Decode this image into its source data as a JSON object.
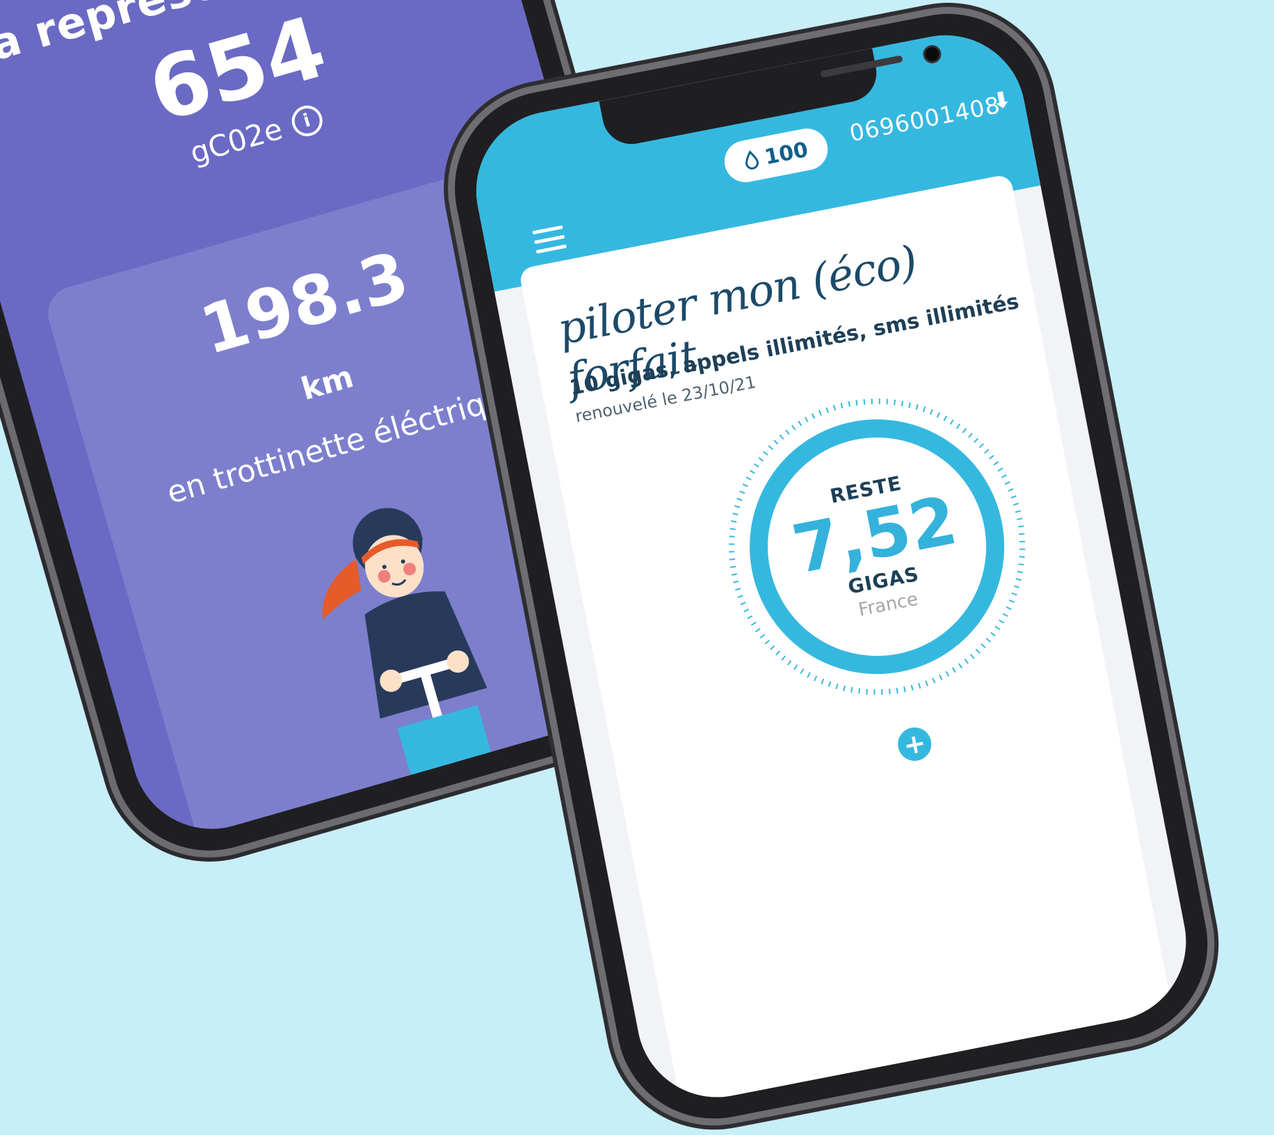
{
  "left_screen": {
    "question": "ça représente quoi ?",
    "total_value": "654",
    "total_unit": "gC02e",
    "equivalence_value": "198.3",
    "equivalence_unit": "km",
    "equivalence_label": "en trottinette éléctrique",
    "info_icon": "info-icon",
    "background_color": "#6a6ac4",
    "card_color": "#7d7fcd"
  },
  "right_screen": {
    "header": {
      "credits": "100",
      "credits_icon": "water-drop-icon",
      "phone_number": "0696001408",
      "download_icon": "download-icon",
      "menu_icon": "hamburger-menu-icon",
      "color": "#35b8e0"
    },
    "card": {
      "title": "piloter mon (éco) forfait",
      "plan": "10 gigas, appels illimités, sms illimités",
      "renewal": "renouvelé le 23/10/21"
    },
    "gauge": {
      "label": "RESTE",
      "value": "7,52",
      "unit": "GIGAS",
      "zone": "France",
      "ring_color": "#35b8e0"
    },
    "add_button_label": "+"
  }
}
